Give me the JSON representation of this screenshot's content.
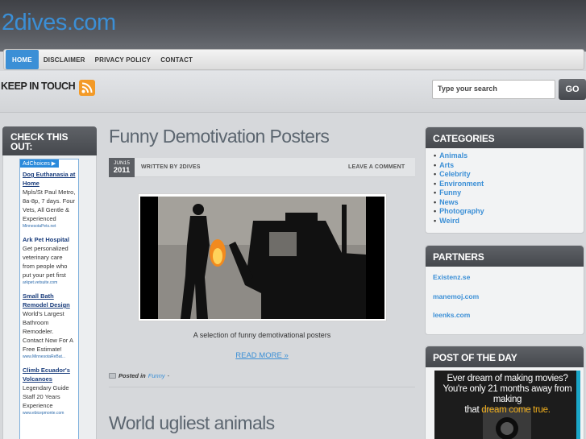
{
  "site": {
    "title": "2dives.com"
  },
  "nav": {
    "items": [
      "HOME",
      "DISCLAIMER",
      "PRIVACY POLICY",
      "CONTACT"
    ]
  },
  "header": {
    "keep_in_touch": "KEEP IN TOUCH"
  },
  "search": {
    "placeholder": "Type your search",
    "button": "GO"
  },
  "left_sidebar": {
    "title": "CHECK THIS OUT:",
    "ad_choices": "AdChoices ▶",
    "ads": [
      {
        "title": "Dog Euthanasia at Home",
        "body": "Mpls/St Paul Metro, 8a-8p, 7 days. Four Vets, All Gentle & Experienced",
        "url": "MinnesotaPets.net"
      },
      {
        "title": "Ark Pet Hospital",
        "body": "Get personalized veterinary care from people who put your pet first",
        "url": "arkpet.vetsuite.com"
      },
      {
        "title": "Small Bath Remodel Design",
        "body": "World's Largest Bathroom Remodeler. Contact Now For A Free Estimate!",
        "url": "www.MinnesotaReBat..."
      },
      {
        "title": "Climb Ecuador's Volcanoes",
        "body": "Legendary Guide Staff 20 Years Experience",
        "url": "www.ebicepmonte.com"
      }
    ]
  },
  "post": {
    "title": "Funny Demotivation Posters",
    "date_md": "JUN15",
    "date_year": "2011",
    "written_by": "WRITTEN BY 2DIVES",
    "leave_comment": "LEAVE A COMMENT",
    "caption": "A selection of funny demotivational posters",
    "read_more": "READ MORE »",
    "posted_in": "Posted in",
    "category": "Funny",
    "category_sep": "-"
  },
  "next_post": {
    "title": "World ugliest animals"
  },
  "categories": {
    "title": "CATEGORIES",
    "items": [
      "Animals",
      "Arts",
      "Celebrity",
      "Environment",
      "Funny",
      "News",
      "Photography",
      "Weird"
    ]
  },
  "partners": {
    "title": "PARTNERS",
    "items": [
      "Existenz.se",
      "manemoj.com",
      "leenks.com"
    ]
  },
  "post_of_day": {
    "title": "POST OF THE DAY",
    "line1": "Ever dream of making movies?",
    "line2": "You're only 21 months away from making",
    "line3_pre": "that",
    "line3_hl": "dream come true."
  },
  "colors": {
    "accent": "#3b8fd6",
    "header_dark": "#45484d",
    "rss": "#f39a27"
  }
}
